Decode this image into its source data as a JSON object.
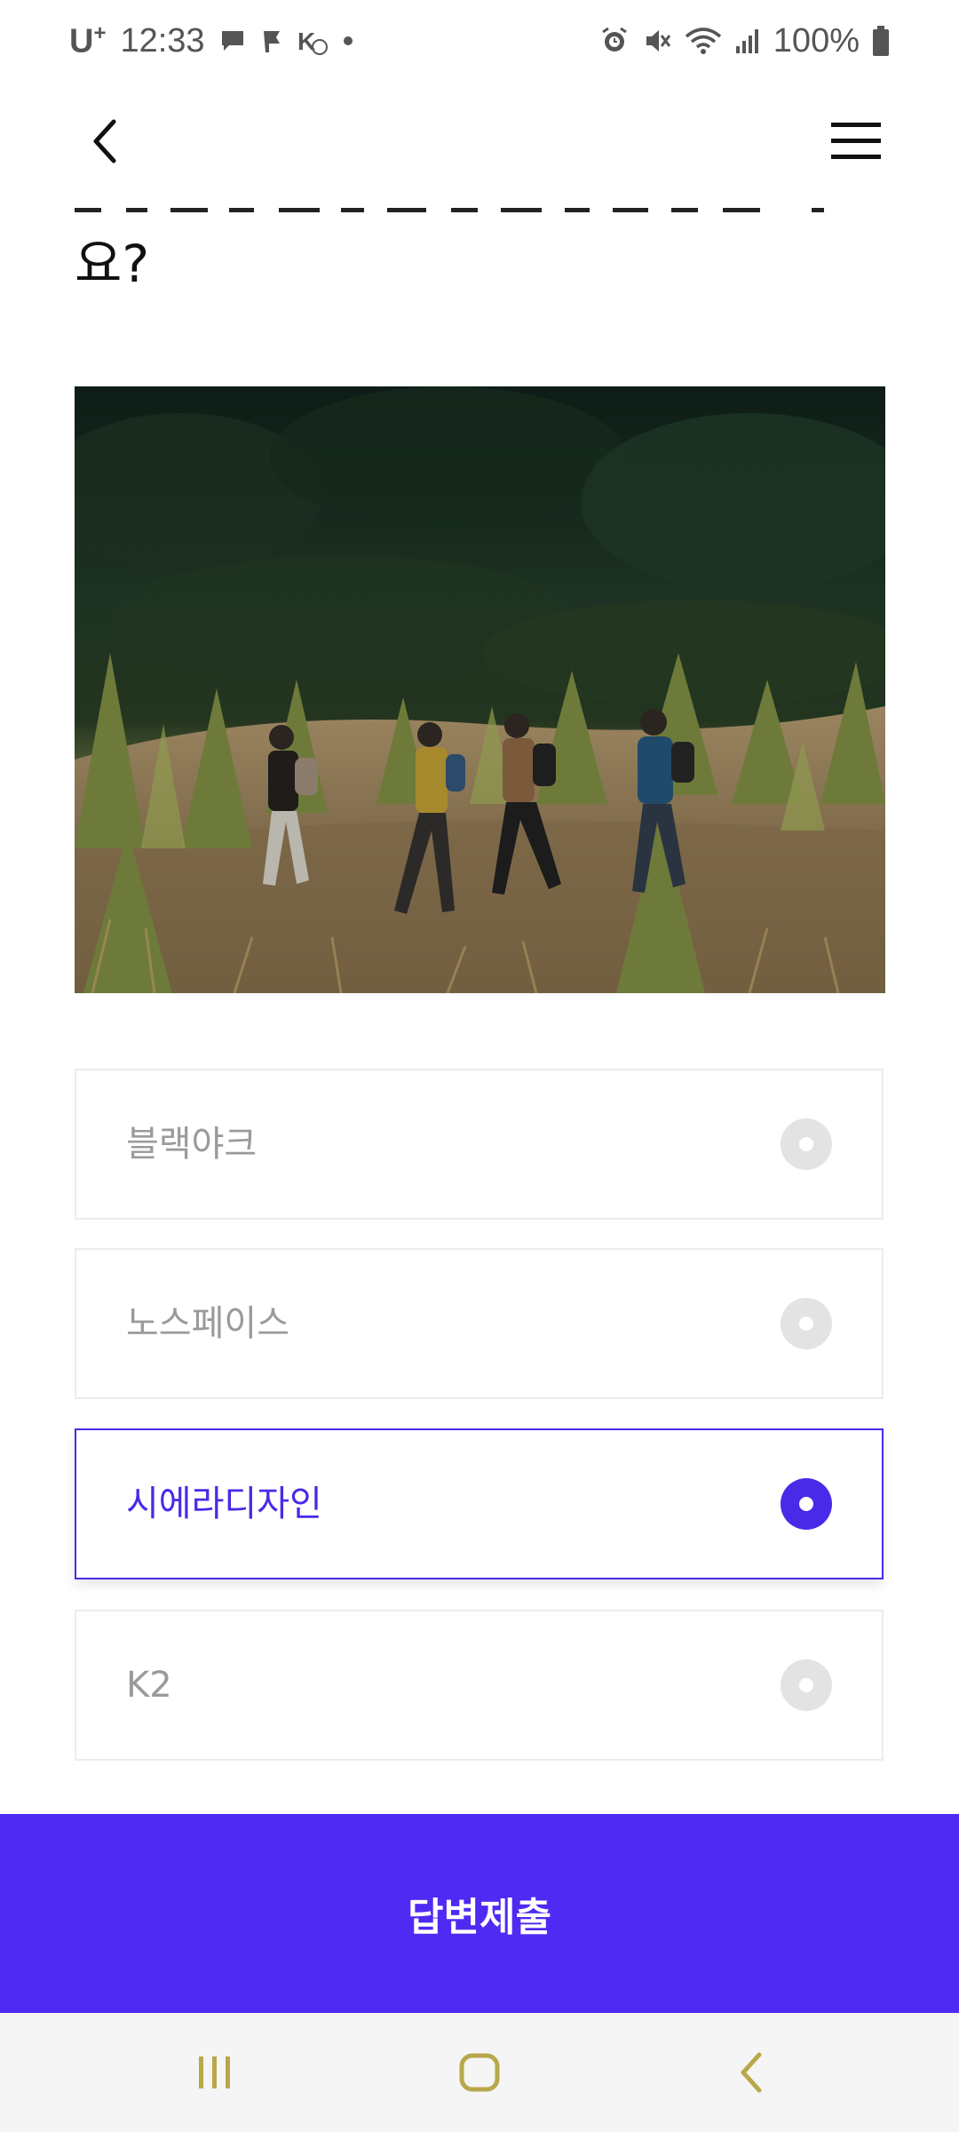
{
  "status_bar": {
    "carrier": "U",
    "carrier_plus": "+",
    "time": "12:33",
    "battery": "100%",
    "left_icons": [
      "chat-bubble-icon",
      "flag-icon",
      "k-badge-icon",
      "dot-icon"
    ],
    "right_icons": [
      "alarm-icon",
      "mute-icon",
      "wifi-icon",
      "signal-icon",
      "battery-icon"
    ]
  },
  "header": {
    "back_icon": "chevron-left-icon",
    "menu_icon": "hamburger-menu-icon"
  },
  "question": {
    "visible_text": "요?"
  },
  "photo": {
    "subject": "hikers-walking-on-hillside"
  },
  "options": [
    {
      "label": "블랙야크",
      "selected": false
    },
    {
      "label": "노스페이스",
      "selected": false
    },
    {
      "label": "시에라디자인",
      "selected": true
    },
    {
      "label": "K2",
      "selected": false
    }
  ],
  "submit": {
    "label": "답변제출"
  },
  "nav_bar": {
    "recents_icon": "recents-icon",
    "home_icon": "home-icon",
    "back_icon": "back-icon"
  },
  "colors": {
    "accent": "#4a2ae8",
    "submit_bg": "#4f2af2",
    "unselected_text": "#9a9a9a",
    "nav_icon": "#b9a84a"
  }
}
